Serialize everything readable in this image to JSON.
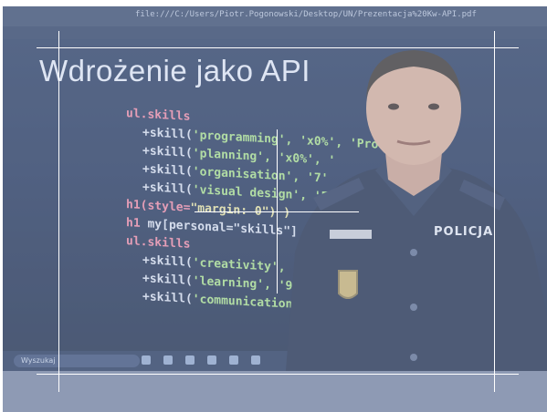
{
  "photo": {
    "browser_url": "file:///C:/Users/Piotr.Pogonowski/Desktop/UN/Prezentacja%20Kw-API.pdf",
    "slide_title": "Wdrożenie jako API",
    "code_lines": [
      {
        "part1": "ul.skills",
        "part2": ""
      },
      {
        "part1": "+skill(",
        "part2": "'programming', 'x0%', 'Pro"
      },
      {
        "part1": "+skill(",
        "part2": "'planning', 'x0%', '"
      },
      {
        "part1": "+skill(",
        "part2": "'organisation', '7'"
      },
      {
        "part1": "+skill(",
        "part2": "'visual design', 'F"
      },
      {
        "part1": "h1(style=",
        "part2": "\"margin: 0\") )"
      },
      {
        "part1": "h1 ",
        "part2": "my[personal=\"skills\"]"
      },
      {
        "part1": "ul.skills",
        "part2": ""
      },
      {
        "part1": "+skill(",
        "part2": "'creativity', '"
      },
      {
        "part1": "+skill(",
        "part2": "'learning', '9'"
      },
      {
        "part1": "+skill(",
        "part2": "'communication"
      }
    ],
    "taskbar_search": "Wyszukaj",
    "badge_text": "POLICJA"
  },
  "colors": {
    "overlay": "#c8d4e8",
    "strip": "#8e9ab4",
    "guide": "#ffffff"
  }
}
